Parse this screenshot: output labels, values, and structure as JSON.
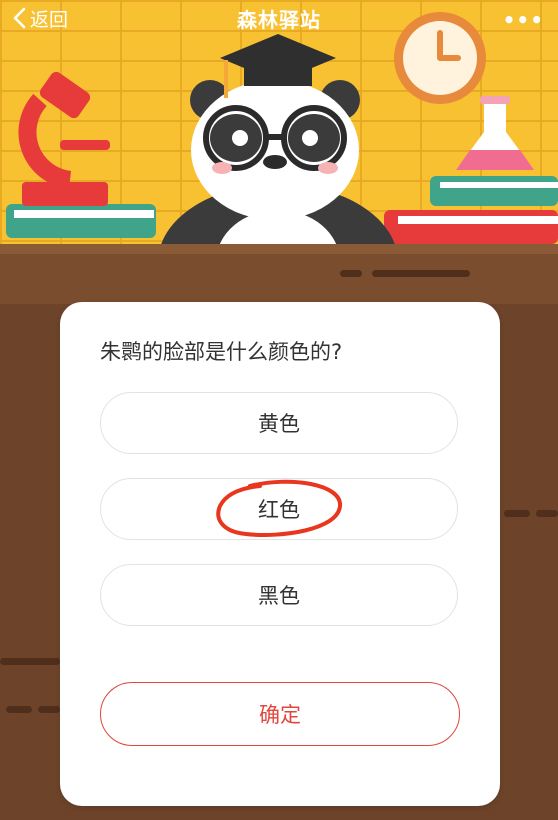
{
  "header": {
    "back_label": "返回",
    "title": "森林驿站",
    "more_label": "•••"
  },
  "quiz": {
    "question": "朱鹮的脸部是什么颜色的?",
    "options": [
      {
        "label": "黄色",
        "circled": false
      },
      {
        "label": "红色",
        "circled": true
      },
      {
        "label": "黑色",
        "circled": false
      }
    ],
    "confirm_label": "确定"
  },
  "colors": {
    "background_yellow": "#f8c132",
    "desk_brown": "#6d4429",
    "accent_red": "#e0473d",
    "text_dark": "#333333",
    "annotation_red": "#e8361f"
  }
}
